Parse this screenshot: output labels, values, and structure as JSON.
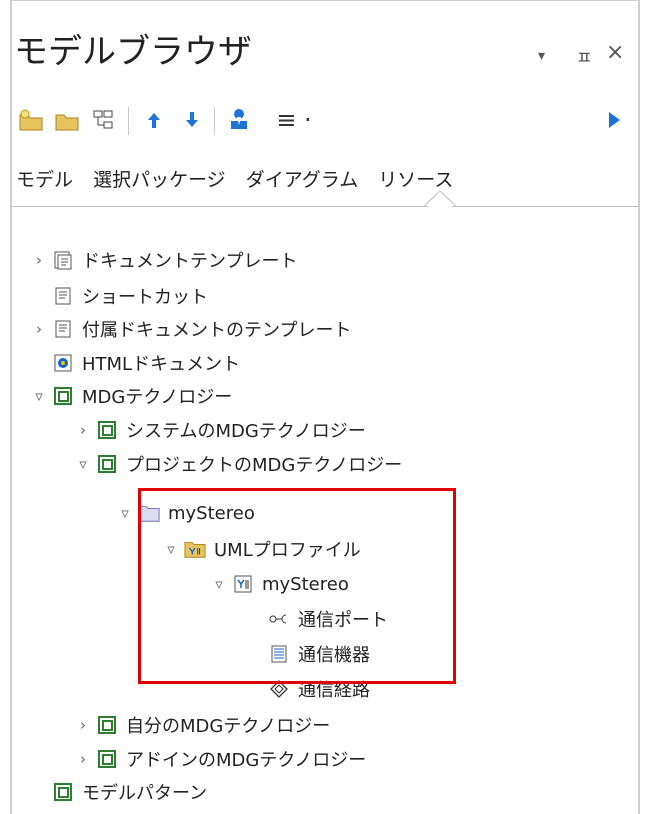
{
  "panel": {
    "title": "モデルブラウザ",
    "controls": {
      "dropdown": "▾",
      "pin": "ㅍ",
      "close": "×"
    }
  },
  "toolbar": {
    "buttons": [
      {
        "name": "new-package-icon"
      },
      {
        "name": "open-folder-icon"
      },
      {
        "name": "diagram-icon"
      },
      {
        "name": "move-up-icon"
      },
      {
        "name": "move-down-icon"
      },
      {
        "name": "user-icon"
      },
      {
        "name": "menu-icon",
        "label": "≡ ·"
      },
      {
        "name": "play-icon"
      }
    ]
  },
  "tabs": [
    {
      "label": "モデル"
    },
    {
      "label": "選択パッケージ"
    },
    {
      "label": "ダイアグラム"
    },
    {
      "label": "リソース"
    }
  ],
  "tree": {
    "items": [
      {
        "label": "ドキュメントテンプレート",
        "twisty": "›"
      },
      {
        "label": "ショートカット",
        "twisty": ""
      },
      {
        "label": "付属ドキュメントのテンプレート",
        "twisty": "›"
      },
      {
        "label": "HTMLドキュメント",
        "twisty": ""
      },
      {
        "label": "MDGテクノロジー",
        "twisty": "▿"
      },
      {
        "label": "システムのMDGテクノロジー",
        "twisty": "›"
      },
      {
        "label": "プロジェクトのMDGテクノロジー",
        "twisty": "▿"
      },
      {
        "label": "myStereo",
        "twisty": "▿"
      },
      {
        "label": "UMLプロファイル",
        "twisty": "▿"
      },
      {
        "label": "myStereo",
        "twisty": "▿"
      },
      {
        "label": "通信ポート",
        "twisty": ""
      },
      {
        "label": "通信機器",
        "twisty": ""
      },
      {
        "label": "通信経路",
        "twisty": ""
      },
      {
        "label": "自分のMDGテクノロジー",
        "twisty": "›"
      },
      {
        "label": "アドインのMDGテクノロジー",
        "twisty": "›"
      },
      {
        "label": "モデルパターン",
        "twisty": ""
      }
    ]
  },
  "colors": {
    "highlight_border": "#e00000",
    "icon_green": "#2e7d32",
    "icon_blue": "#1565c0",
    "folder_yellow": "#e6c35c"
  }
}
